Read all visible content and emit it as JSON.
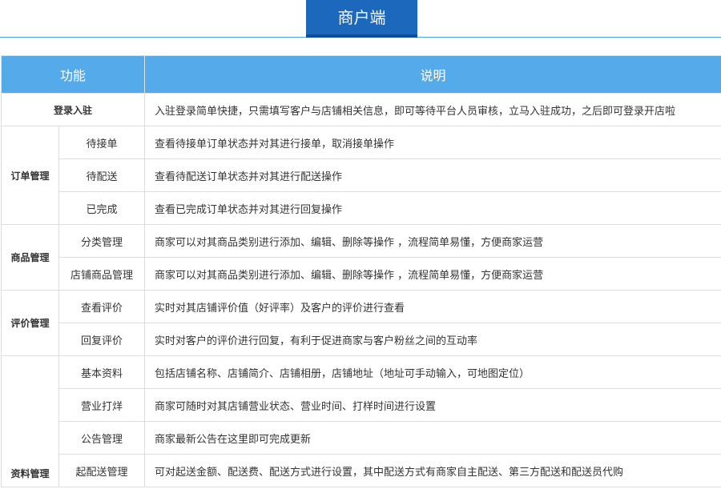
{
  "header": {
    "title": "商户端"
  },
  "table": {
    "col_function": "功能",
    "col_desc": "说明",
    "login": {
      "label": "登录入驻",
      "desc": "入驻登录简单快捷，只需填写客户与店铺相关信息，即可等待平台人员审核，立马入驻成功，之后即可登录开店啦"
    },
    "groups": [
      {
        "label": "订单管理",
        "items": [
          {
            "label": "待接单",
            "desc": "查看待接单订单状态并对其进行接单，取消接单操作"
          },
          {
            "label": "待配送",
            "desc": "查看待配送订单状态并对其进行配送操作"
          },
          {
            "label": "已完成",
            "desc": "查看已完成订单状态并对其进行回复操作"
          }
        ]
      },
      {
        "label": "商品管理",
        "items": [
          {
            "label": "分类管理",
            "desc": "商家可以对其商品类别进行添加、编辑、删除等操作 ，流程简单易懂，方便商家运营"
          },
          {
            "label": "店铺商品管理",
            "desc": "商家可以对其商品类别进行添加、编辑、删除等操作 ，流程简单易懂，方便商家运营"
          }
        ]
      },
      {
        "label": "评价管理",
        "items": [
          {
            "label": "查看评价",
            "desc": "实时对其店铺评价值（好评率）及客户的评价进行查看"
          },
          {
            "label": "回复评价",
            "desc": "实时对客户的评价进行回复，有利于促进商家与客户粉丝之间的互动率"
          }
        ]
      },
      {
        "label": "资料管理",
        "items": [
          {
            "label": "基本资料",
            "desc": "包括店铺名称、店铺简介、店铺相册，店铺地址（地址可手动输入，可地图定位）"
          },
          {
            "label": "营业打烊",
            "desc": "商家可随时对其店铺营业状态、营业时间、打样时间进行设置"
          },
          {
            "label": "公告管理",
            "desc": "商家最新公告在这里即可完成更新"
          },
          {
            "label": "起配送管理",
            "desc": "可对起送金额、配送费、配送方式进行设置，其中配送方式有商家自主配送、第三方配送和配送员代购"
          }
        ]
      }
    ]
  }
}
